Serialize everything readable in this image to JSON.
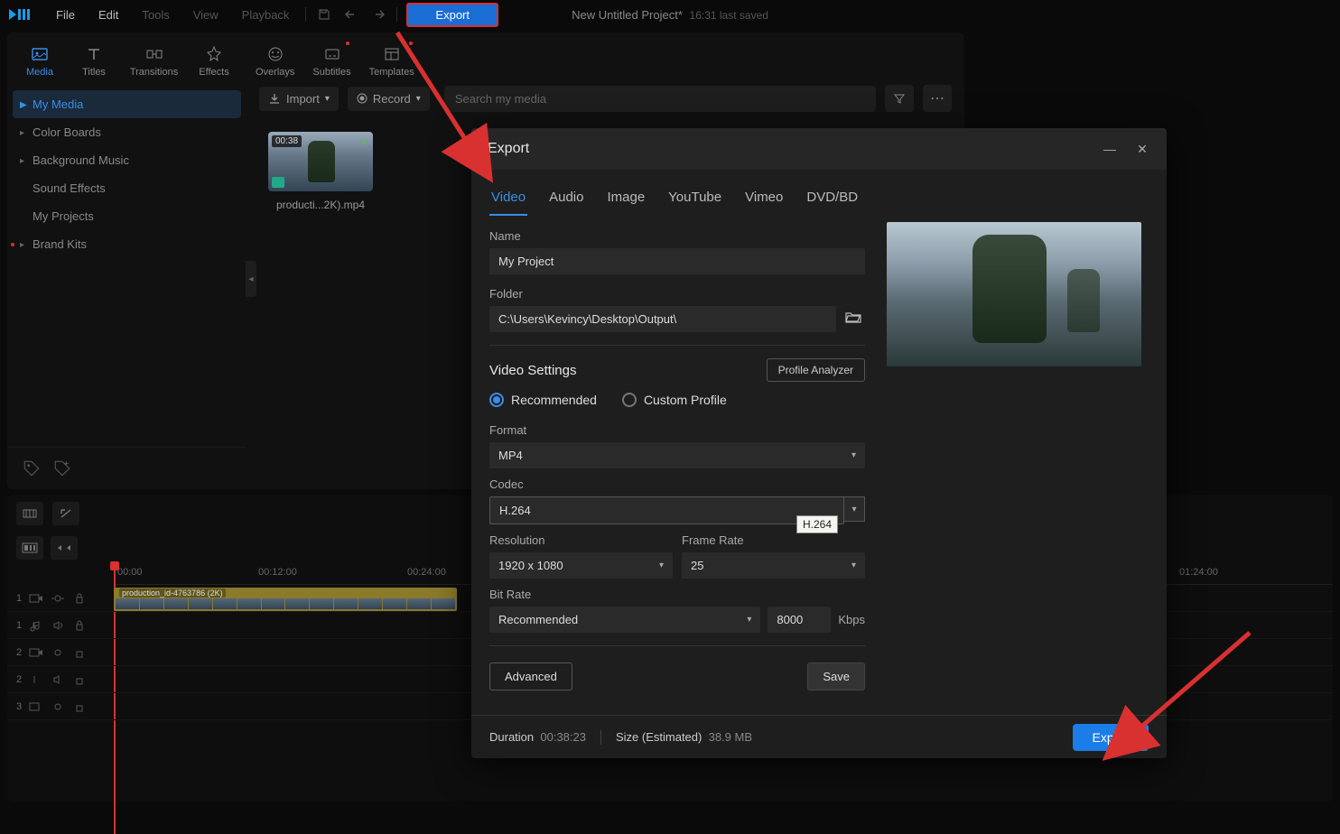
{
  "menubar": {
    "items": [
      "File",
      "Edit",
      "Tools",
      "View",
      "Playback"
    ],
    "export_label": "Export",
    "project_name": "New Untitled Project*",
    "saved_info": "16:31 last saved"
  },
  "panel_tabs": [
    "Media",
    "Titles",
    "Transitions",
    "Effects",
    "Overlays",
    "Subtitles",
    "Templates"
  ],
  "sidebar": {
    "items": [
      {
        "label": "My Media",
        "active": true,
        "caret": true
      },
      {
        "label": "Color Boards",
        "caret": true
      },
      {
        "label": "Background Music",
        "caret": true
      },
      {
        "label": "Sound Effects"
      },
      {
        "label": "My Projects"
      },
      {
        "label": "Brand Kits",
        "caret": true,
        "reddot": true
      }
    ]
  },
  "media_toolbar": {
    "import": "Import",
    "record": "Record",
    "search_placeholder": "Search my media"
  },
  "media_item": {
    "duration": "00:38",
    "name": "producti...2K).mp4"
  },
  "timeline": {
    "ticks": [
      "00:00",
      "00:12:00",
      "00:24:00",
      "01:24:00"
    ],
    "clip_name": "production_id-4763786 (2K)",
    "rows": [
      "1",
      "1",
      "2",
      "2",
      "3"
    ]
  },
  "export_dialog": {
    "title": "Export",
    "tabs": [
      "Video",
      "Audio",
      "Image",
      "YouTube",
      "Vimeo",
      "DVD/BD"
    ],
    "name_label": "Name",
    "name_value": "My Project",
    "folder_label": "Folder",
    "folder_value": "C:\\Users\\Kevincy\\Desktop\\Output\\",
    "video_settings": "Video Settings",
    "profile_analyzer": "Profile Analyzer",
    "recommended": "Recommended",
    "custom_profile": "Custom Profile",
    "format_label": "Format",
    "format_value": "MP4",
    "codec_label": "Codec",
    "codec_value": "H.264",
    "codec_tooltip": "H.264",
    "resolution_label": "Resolution",
    "resolution_value": "1920 x 1080",
    "framerate_label": "Frame Rate",
    "framerate_value": "25",
    "bitrate_label": "Bit Rate",
    "bitrate_mode": "Recommended",
    "bitrate_value": "8000",
    "bitrate_unit": "Kbps",
    "advanced": "Advanced",
    "save": "Save",
    "duration_label": "Duration",
    "duration_value": "00:38:23",
    "size_label": "Size (Estimated)",
    "size_value": "38.9 MB",
    "export_cta": "Export"
  }
}
